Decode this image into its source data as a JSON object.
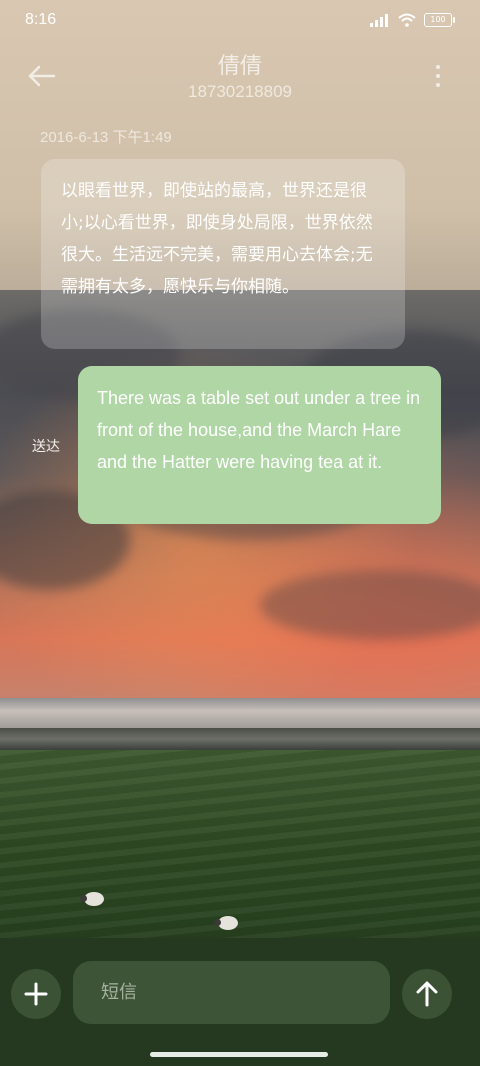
{
  "status_bar": {
    "time": "8:16",
    "battery": "100"
  },
  "header": {
    "contact_name": "倩倩",
    "contact_number": "18730218809"
  },
  "conversation": {
    "timestamp": "2016-6-13 下午1:49",
    "messages": [
      {
        "direction": "incoming",
        "text": "以眼看世界，即使站的最高，世界还是很小;以心看世界，即使身处局限，世界依然很大。生活远不完美，需要用心去体会;无需拥有太多，愿快乐与你相随。"
      },
      {
        "direction": "outgoing",
        "text": "There was a table set out under a tree in front of the house,and the March Hare and the Hatter were having tea at it.",
        "status": "送达"
      }
    ]
  },
  "composer": {
    "placeholder": "短信"
  },
  "icons": {
    "back": "arrow-left-icon",
    "more": "more-vertical-icon",
    "add": "plus-icon",
    "send": "arrow-up-icon"
  },
  "colors": {
    "outgoing_bubble": "#b0d6a6",
    "composer_bg": "#24391f"
  }
}
